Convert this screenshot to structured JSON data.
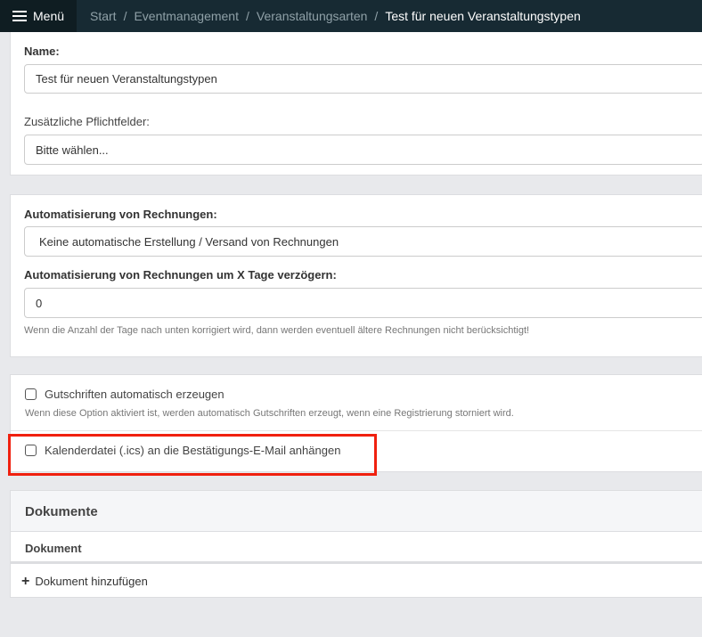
{
  "topbar": {
    "menu_label": "Menü",
    "breadcrumb": [
      "Start",
      "Eventmanagement",
      "Veranstaltungsarten",
      "Test für neuen Veranstaltungstypen"
    ],
    "separator": "/"
  },
  "card1": {
    "name_label": "Name:",
    "name_value": "Test für neuen Veranstaltungstypen",
    "extra_label": "Zusätzliche Pflichtfelder:",
    "extra_value": "Bitte wählen..."
  },
  "card2": {
    "invoice_label": "Automatisierung von Rechnungen:",
    "invoice_value": "Keine automatische Erstellung / Versand von Rechnungen",
    "delay_label": "Automatisierung von Rechnungen um X Tage verzögern:",
    "delay_value": "0",
    "delay_help": "Wenn die Anzahl der Tage nach unten korrigiert wird, dann werden eventuell ältere Rechnungen nicht berücksichtigt!"
  },
  "card3": {
    "credit_label": "Gutschriften automatisch erzeugen",
    "credit_checked": false,
    "credit_help": "Wenn diese Option aktiviert ist, werden automatisch Gutschriften erzeugt, wenn eine Registrierung storniert wird.",
    "ics_label": "Kalenderdatei (.ics) an die Bestätigungs-E-Mail anhängen",
    "ics_checked": false
  },
  "documents": {
    "title": "Dokumente",
    "column": "Dokument",
    "add_label": "Dokument hinzufügen"
  },
  "colors": {
    "highlight": "#f0200f",
    "topbar": "#172a33"
  }
}
